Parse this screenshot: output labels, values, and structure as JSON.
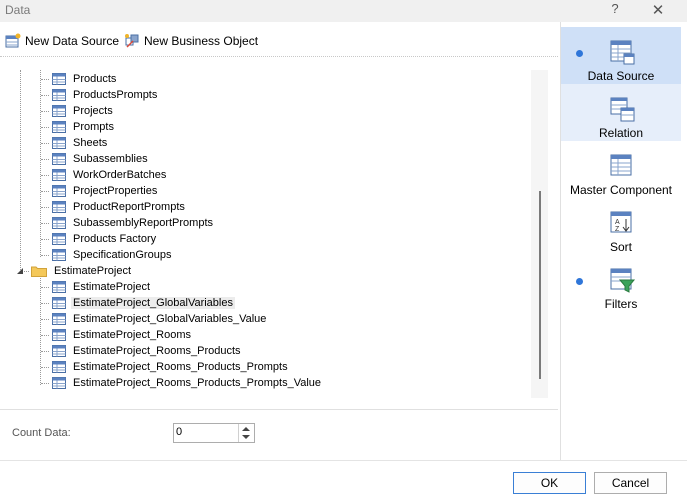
{
  "window": {
    "title": "Data",
    "help": "?",
    "close": "✕"
  },
  "toolbar": {
    "new_data_source": "New Data Source",
    "new_business_object": "New Business Object"
  },
  "tree": {
    "group1_items": [
      "Products",
      "ProductsPrompts",
      "Projects",
      "Prompts",
      "Sheets",
      "Subassemblies",
      "WorkOrderBatches",
      "ProjectProperties",
      "ProductReportPrompts",
      "SubassemblyReportPrompts",
      "Products Factory",
      "SpecificationGroups"
    ],
    "folder": "EstimateProject",
    "group2_items": [
      "EstimateProject",
      "EstimateProject_GlobalVariables",
      "EstimateProject_GlobalVariables_Value",
      "EstimateProject_Rooms",
      "EstimateProject_Rooms_Products",
      "EstimateProject_Rooms_Products_Prompts",
      "EstimateProject_Rooms_Products_Prompts_Value"
    ],
    "selected": "EstimateProject_GlobalVariables"
  },
  "count": {
    "label": "Count Data:",
    "value": "0"
  },
  "side": {
    "data_source": "Data Source",
    "relation": "Relation",
    "master_component": "Master Component",
    "sort": "Sort",
    "filters": "Filters"
  },
  "buttons": {
    "ok": "OK",
    "cancel": "Cancel"
  },
  "colors": {
    "accent": "#2f76d9",
    "active_bg": "#cfe0f7",
    "hover_bg": "#e6eefa"
  }
}
